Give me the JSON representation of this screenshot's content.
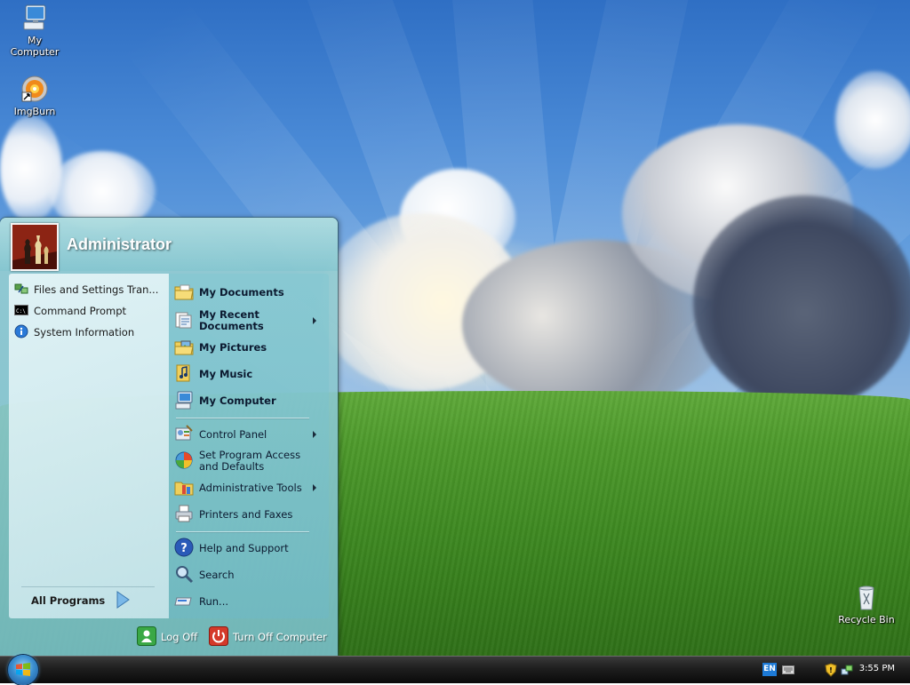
{
  "desktop": {
    "icons": [
      {
        "label": "My Computer",
        "icon": "my-computer-icon"
      },
      {
        "label": "ImgBurn",
        "icon": "imgburn-icon"
      },
      {
        "label": "Recycle Bin",
        "icon": "recycle-bin-icon"
      }
    ]
  },
  "start_menu": {
    "user": "Administrator",
    "left_items": [
      {
        "label": "Files and Settings Tran...",
        "icon": "files-settings-transfer-icon"
      },
      {
        "label": "Command Prompt",
        "icon": "command-prompt-icon"
      },
      {
        "label": "System Information",
        "icon": "system-information-icon"
      }
    ],
    "all_programs": "All Programs",
    "right_items": [
      {
        "label": "My Documents",
        "icon": "folder-documents-icon",
        "bold": true
      },
      {
        "label": "My Recent\nDocuments",
        "icon": "recent-documents-icon",
        "bold": true,
        "submenu": true
      },
      {
        "label": "My Pictures",
        "icon": "folder-pictures-icon",
        "bold": true
      },
      {
        "label": "My Music",
        "icon": "music-icon",
        "bold": true
      },
      {
        "label": "My Computer",
        "icon": "my-computer-icon",
        "bold": true
      },
      {
        "label": "Control Panel",
        "icon": "control-panel-icon",
        "submenu": true
      },
      {
        "label": "Set Program Access\nand Defaults",
        "icon": "program-defaults-icon"
      },
      {
        "label": "Administrative Tools",
        "icon": "admin-tools-icon",
        "submenu": true
      },
      {
        "label": "Printers and Faxes",
        "icon": "printer-icon"
      },
      {
        "label": "Help and Support",
        "icon": "help-icon"
      },
      {
        "label": "Search",
        "icon": "search-icon"
      },
      {
        "label": "Run...",
        "icon": "run-icon"
      }
    ],
    "log_off": "Log Off",
    "turn_off": "Turn Off Computer"
  },
  "taskbar": {
    "language": "EN",
    "clock": "3:55 PM"
  },
  "colors": {
    "accent": "#1d7ad6",
    "menu_glass": "#78bec8",
    "log_off_green": "#3aa845",
    "power_red": "#d43a2a"
  }
}
